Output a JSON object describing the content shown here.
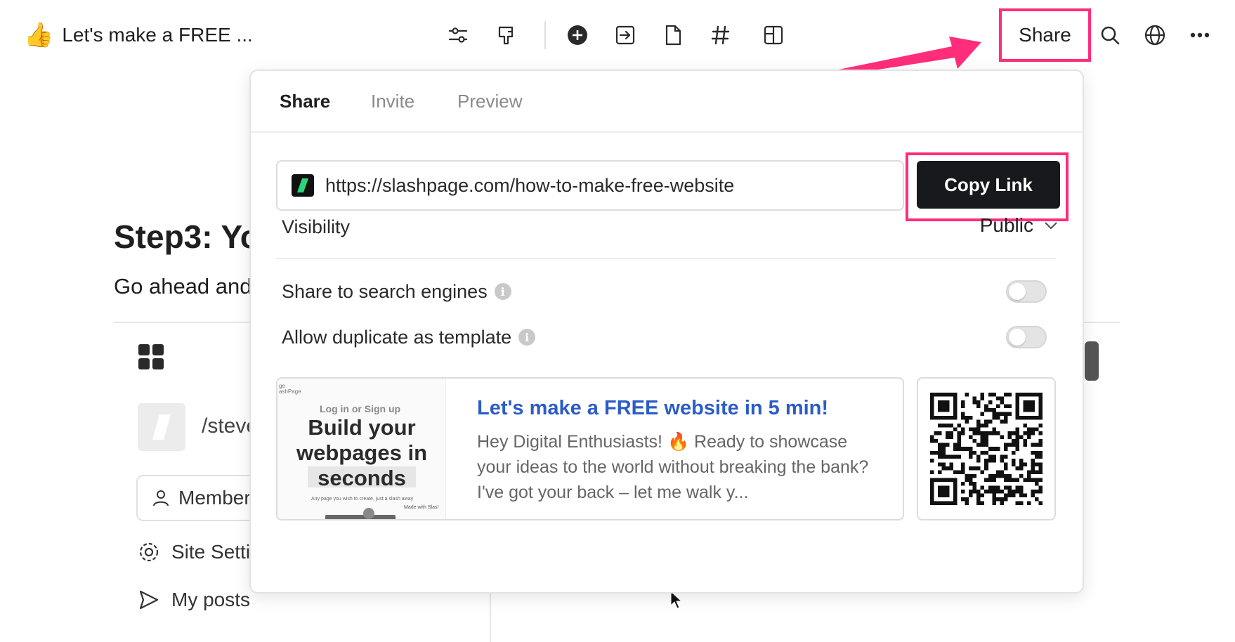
{
  "topbar": {
    "emoji": "👍",
    "title": "Let's make a FREE ...",
    "share_label": "Share",
    "tool_icons": [
      "sliders-icon",
      "pin-icon",
      "plus-circle-icon",
      "arrow-box-icon",
      "file-icon",
      "hash-icon",
      "layout-icon"
    ],
    "right_icons": [
      "search-icon",
      "globe-icon",
      "more-icon"
    ]
  },
  "background": {
    "heading": "Step3: Yo",
    "paragraph": "Go ahead and",
    "slug": "/steve",
    "member_label": "Member",
    "nav_items": [
      {
        "label": "Site Setti",
        "icon": "gear-icon"
      },
      {
        "label": "My posts",
        "icon": "send-icon"
      }
    ]
  },
  "modal": {
    "tabs": [
      "Share",
      "Invite",
      "Preview"
    ],
    "active_tab": "Share",
    "url": "https://slashpage.com/how-to-make-free-website",
    "copy_label": "Copy Link",
    "visibility_label": "Visibility",
    "visibility_value": "Public",
    "options": [
      {
        "label": "Share to search engines",
        "enabled": false
      },
      {
        "label": "Allow duplicate as template",
        "enabled": false
      }
    ],
    "preview": {
      "title": "Let's make a FREE website in 5 min!",
      "description": "Hey Digital Enthusiasts! 🔥 Ready to showcase your ideas to the world without breaking the bank? I've got your back – let me walk y...",
      "thumb_brand_line1": "ge",
      "thumb_brand_line2": "ashPage",
      "thumb_login": "Log in or Sign up",
      "thumb_headline": "Build your webpages in seconds",
      "thumb_sub": "Any page you wish to create, just a slash away",
      "thumb_made": "Made with Slas!"
    }
  },
  "colors": {
    "highlight": "#ff2d7a",
    "link": "#2b5cc8",
    "button_bg": "#17191c"
  }
}
